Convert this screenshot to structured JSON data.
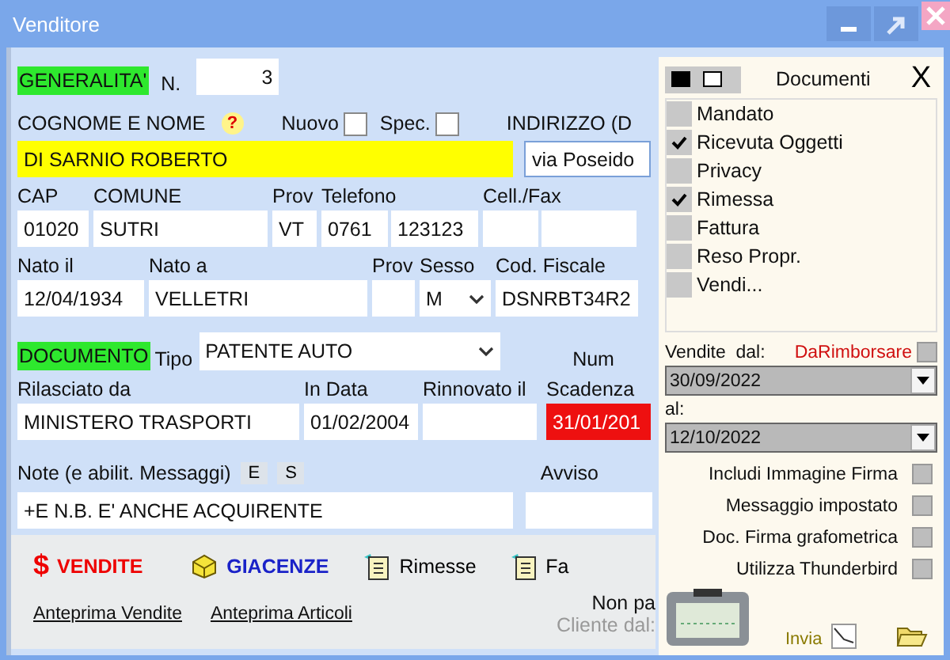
{
  "window": {
    "title": "Venditore"
  },
  "generalita": {
    "section_label": "GENERALITA'",
    "number_label": "N.",
    "number": "3"
  },
  "name": {
    "label": "COGNOME E NOME",
    "help_icon": "?",
    "value": "DI SARNIO ROBERTO"
  },
  "flags": [
    {
      "label": "Nuovo",
      "checked": false
    },
    {
      "label": "Spec.",
      "checked": false
    }
  ],
  "address": {
    "label": "INDIRIZZO (D",
    "value": "via Poseido"
  },
  "contact_row": [
    {
      "label": "CAP",
      "kind": "single",
      "values": [
        "01020"
      ]
    },
    {
      "label": "COMUNE",
      "kind": "single",
      "values": [
        "SUTRI"
      ]
    },
    {
      "label": "Prov",
      "kind": "single",
      "values": [
        "VT"
      ]
    },
    {
      "label": "Telefono",
      "kind": "pair",
      "values": [
        "0761",
        "123123"
      ]
    },
    {
      "label": "Cell./Fax",
      "kind": "pair"
    }
  ],
  "birth_row": [
    {
      "label": "Nato il",
      "kind": "single",
      "values": [
        "12/04/1934"
      ]
    },
    {
      "label": "Nato a",
      "kind": "single",
      "values": [
        "VELLETRI"
      ]
    },
    {
      "label": "Prov",
      "kind": "single"
    },
    {
      "label": "Sesso",
      "kind": "select",
      "values": [
        "M"
      ]
    },
    {
      "label": "Cod. Fiscale",
      "kind": "single",
      "values": [
        "DSNRBT34R2"
      ]
    }
  ],
  "document": {
    "section_label": "DOCUMENTO",
    "type_label": "Tipo",
    "type_value": "PATENTE AUTO",
    "number_label": "Num"
  },
  "document_row": [
    {
      "label": "Rilasciato da",
      "kind": "single",
      "values": [
        "MINISTERO TRASPORTI"
      ],
      "expired": false
    },
    {
      "label": "In Data",
      "kind": "single",
      "values": [
        "01/02/2004"
      ],
      "expired": false
    },
    {
      "label": "Rinnovato il",
      "kind": "single",
      "expired": false
    },
    {
      "label": "Scadenza",
      "kind": "single",
      "values": [
        "31/01/201"
      ],
      "expired": true
    }
  ],
  "notes": {
    "label": "Note (e abilit. Messaggi)",
    "buttons": [
      "E",
      "S"
    ],
    "value": "+E  N.B. E' ANCHE ACQUIRENTE",
    "notice_label": "Avviso"
  },
  "toolbar": {
    "buttons": [
      {
        "kind": "sales",
        "icon": "$",
        "label": "VENDITE"
      },
      {
        "kind": "stock",
        "label": "GIACENZE"
      },
      {
        "kind": "doc",
        "label": "Rimesse"
      },
      {
        "kind": "doc",
        "label": "Fa"
      }
    ],
    "links": [
      "Anteprima Vendite",
      "Anteprima Articoli"
    ],
    "unpaid_label": "Non pa",
    "client_since_label": "Cliente dal:"
  },
  "panel": {
    "title": "Documenti",
    "close": "X",
    "items": [
      {
        "label": "Mandato",
        "checked": false
      },
      {
        "label": "Ricevuta Oggetti",
        "checked": true
      },
      {
        "label": "Privacy",
        "checked": false
      },
      {
        "label": "Rimessa",
        "checked": true
      },
      {
        "label": "Fattura",
        "checked": false
      },
      {
        "label": "Reso Propr.",
        "checked": false
      },
      {
        "label": "Vendi...",
        "checked": false
      }
    ],
    "sales_from_label": "Vendite  dal:",
    "refund": {
      "label": "DaRimborsare",
      "checked": false
    },
    "date_from": "30/09/2022",
    "to_label": "al:",
    "date_to": "12/10/2022",
    "options": [
      {
        "label": "Includi Immagine Firma",
        "checked": false
      },
      {
        "label": "Messaggio impostato",
        "checked": false
      },
      {
        "label": "Doc.  Firma grafometrica",
        "checked": false
      },
      {
        "label": "Utilizza Thunderbird",
        "checked": false
      }
    ],
    "send_label": "Invia"
  }
}
